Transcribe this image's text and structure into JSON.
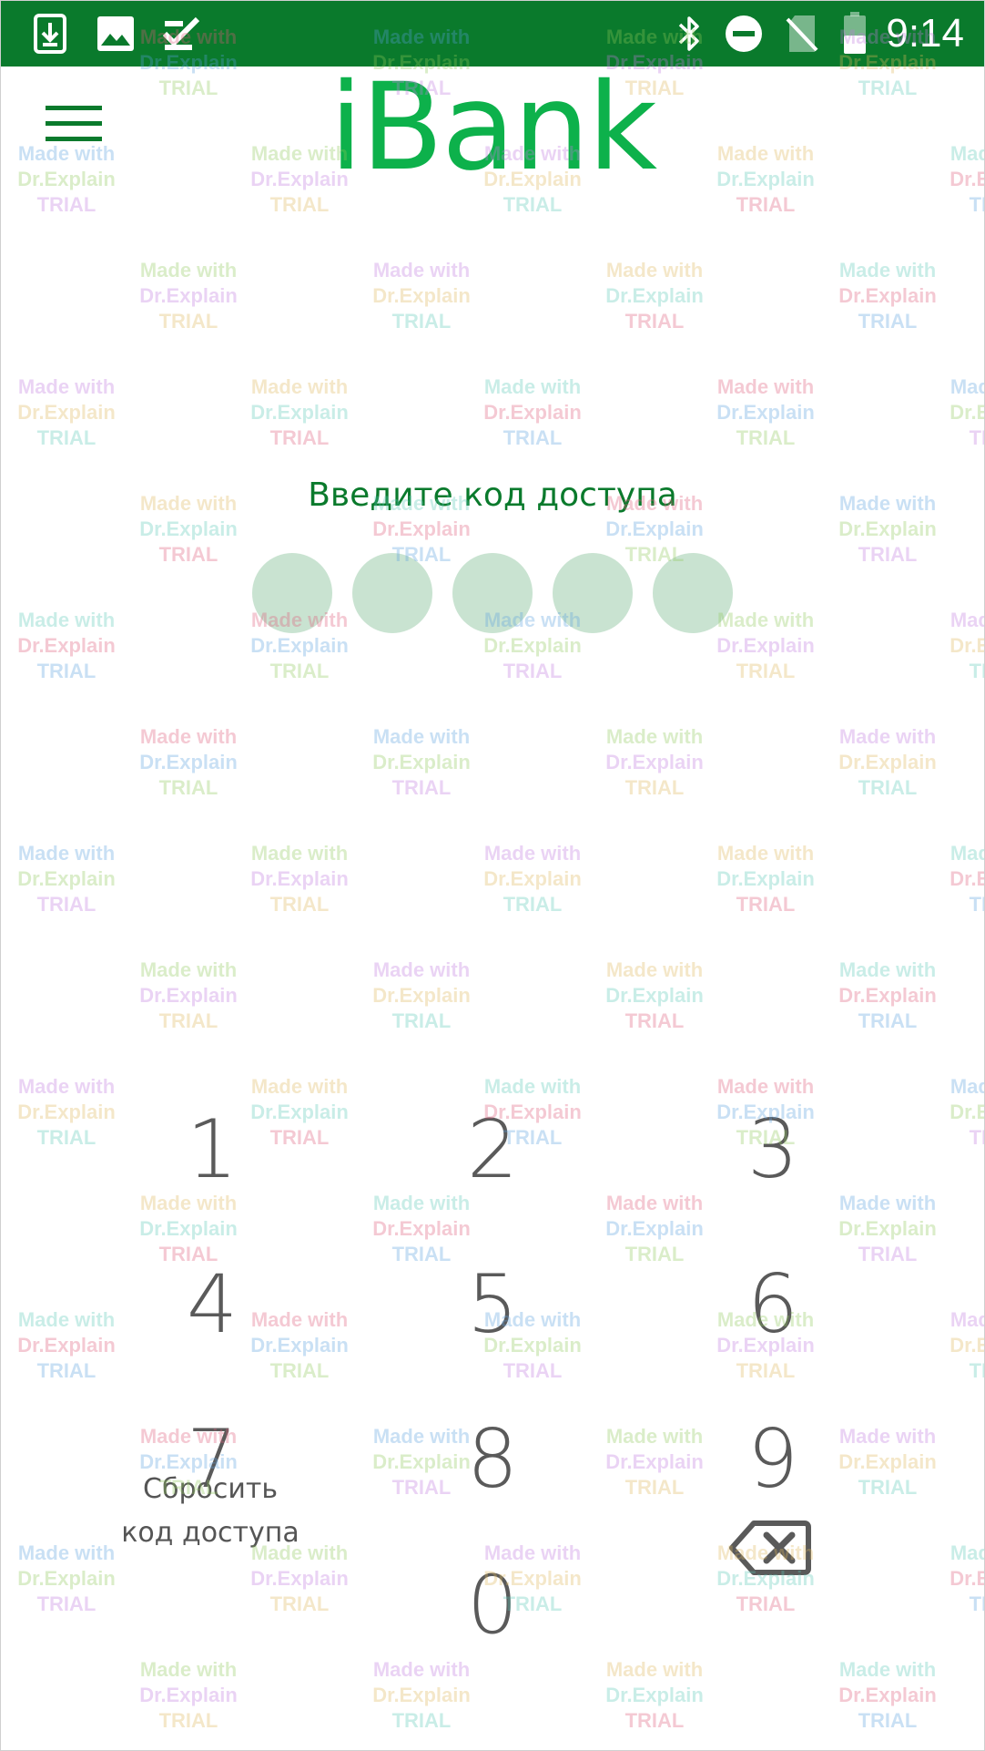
{
  "status_bar": {
    "time": "9:14",
    "left_icons": [
      "download-icon",
      "image-icon",
      "task-check-icon"
    ],
    "right_icons": [
      "bluetooth-icon",
      "do-not-disturb-icon",
      "no-sim-icon",
      "battery-icon"
    ],
    "background": "#0a7a2c"
  },
  "app_bar": {
    "title": "iBank",
    "menu_icon": "hamburger-menu-icon",
    "title_color": "#0db14b"
  },
  "passcode": {
    "prompt": "Введите код доступа",
    "entered_digits": 0,
    "total_digits": 5,
    "dot_color": "#c9e3d1"
  },
  "keypad": {
    "keys": [
      "1",
      "2",
      "3",
      "4",
      "5",
      "6",
      "7",
      "8",
      "9",
      "0"
    ],
    "reset_line1": "Сбросить",
    "reset_line2": "код доступа",
    "backspace_icon": "backspace-icon"
  },
  "watermark": {
    "line1": "Made with",
    "line2": "Dr.Explain",
    "line3": "TRIAL"
  }
}
